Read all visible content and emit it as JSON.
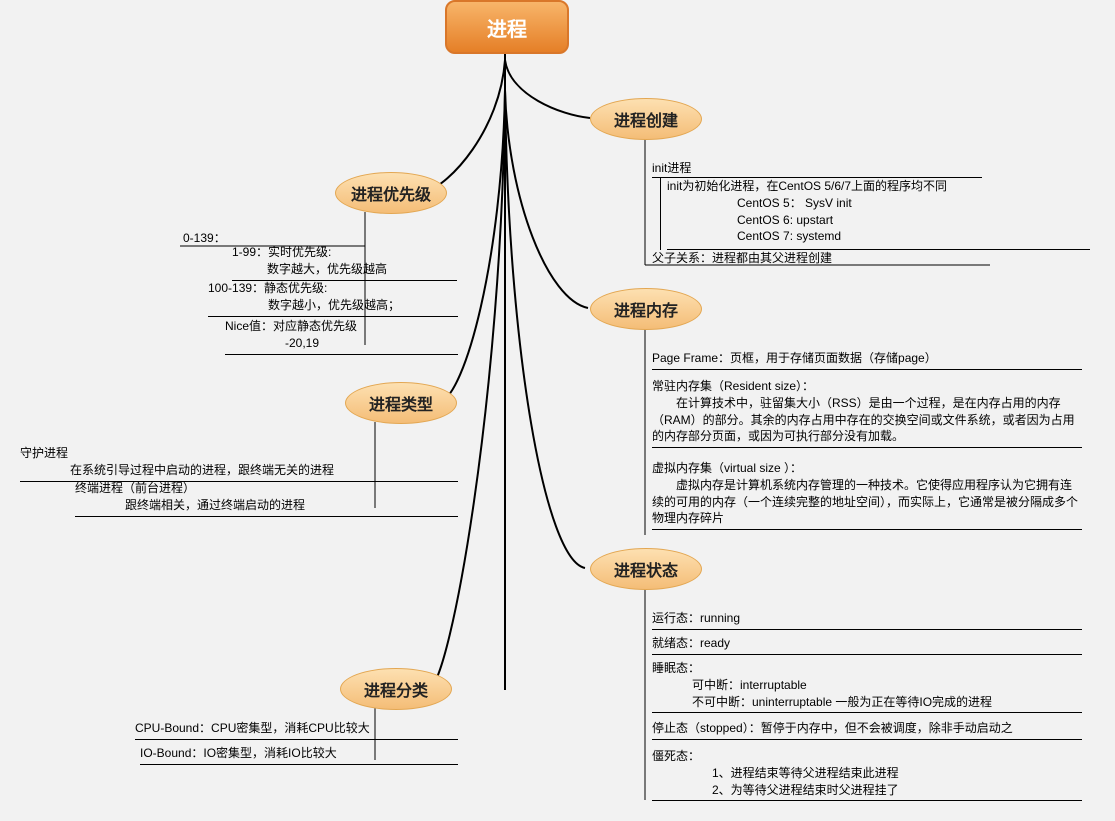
{
  "root": "进程",
  "branches": {
    "priority": {
      "title": "进程优先级",
      "range_label": "0-139：",
      "line1": "1-99：实时优先级:",
      "line1sub": "数字越大，优先级越高",
      "line2": "100-139：静态优先级:",
      "line2sub": "数字越小，优先级越高；",
      "nice": "Nice值：对应静态优先级",
      "nicesub": "-20,19"
    },
    "type": {
      "title": "进程类型",
      "daemon_title": "守护进程",
      "daemon_body": "在系统引导过程中启动的进程，跟终端无关的进程",
      "term_title": "终端进程（前台进程）",
      "term_body": "跟终端相关，通过终端启动的进程"
    },
    "category": {
      "title": "进程分类",
      "cpu": "CPU-Bound：CPU密集型，消耗CPU比较大",
      "io": "IO-Bound：IO密集型，消耗IO比较大"
    },
    "create": {
      "title": "进程创建",
      "init_label": "init进程",
      "init_body1": "init为初始化进程，在CentOS 5/6/7上面的程序均不同",
      "init_body2": "CentOS 5： SysV init",
      "init_body3": "CentOS 6: upstart",
      "init_body4": "CentOS 7: systemd",
      "parent": "父子关系：进程都由其父进程创建"
    },
    "memory": {
      "title": "进程内存",
      "pageframe": "Page Frame：页框，用于存储页面数据（存储page）",
      "rss_title": "常驻内存集（Resident size）：",
      "rss_body": "在计算技术中，驻留集大小（RSS）是由一个过程，是在内存占用的内存（RAM）的部分。其余的内存占用中存在的交换空间或文件系统，或者因为占用的内存部分页面，或因为可执行部分没有加载。",
      "virt_title": "虚拟内存集（virtual size ）：",
      "virt_body": "虚拟内存是计算机系统内存管理的一种技术。它使得应用程序认为它拥有连续的可用的内存（一个连续完整的地址空间），而实际上，它通常是被分隔成多个物理内存碎片"
    },
    "state": {
      "title": "进程状态",
      "running": "运行态：running",
      "ready": "就绪态：ready",
      "sleep_title": "睡眠态：",
      "sleep1": "可中断：interruptable",
      "sleep2": "不可中断：uninterruptable 一般为正在等待IO完成的进程",
      "stopped": "停止态（stopped）：暂停于内存中，但不会被调度，除非手动启动之",
      "zombie_title": "僵死态：",
      "zombie1": "1、进程结束等待父进程结束此进程",
      "zombie2": "2、为等待父进程结束时父进程挂了"
    }
  }
}
